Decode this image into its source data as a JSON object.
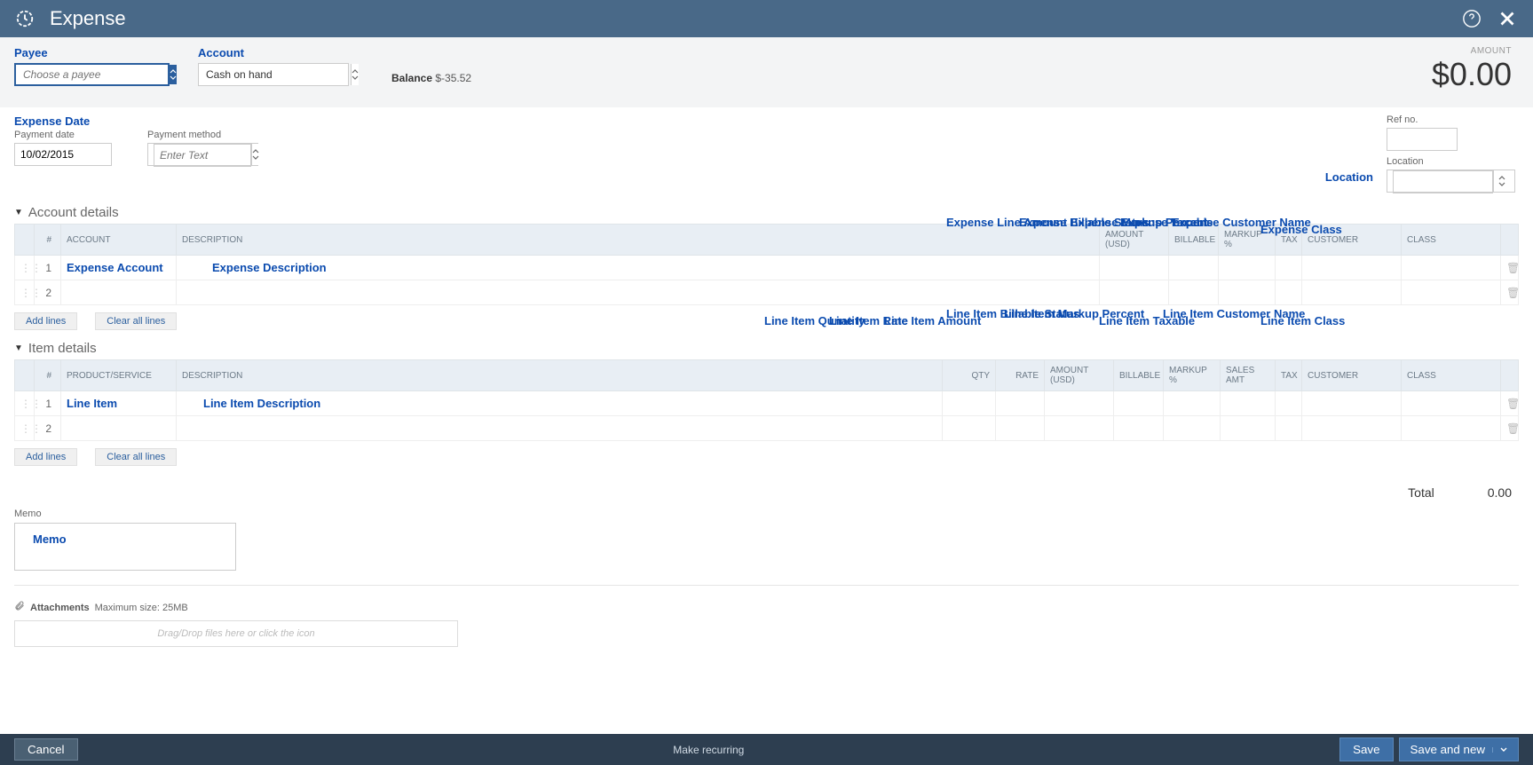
{
  "header": {
    "title": "Expense"
  },
  "top": {
    "payee_label": "Payee",
    "payee_placeholder": "Choose a payee",
    "account_label": "Account",
    "account_value": "Cash on hand",
    "balance_label": "Balance",
    "balance_value": "$-35.52",
    "amount_label": "AMOUNT",
    "amount_value": "$0.00"
  },
  "second_row": {
    "expense_date_label": "Expense Date",
    "payment_date_label": "Payment date",
    "payment_date_value": "10/02/2015",
    "payment_method_label": "Payment method",
    "payment_method_placeholder": "Enter Text",
    "ref_no_label": "Ref no.",
    "location_label": "Location",
    "location_annotation": "Location"
  },
  "account_details": {
    "section_title": "Account details",
    "headers": {
      "num": "#",
      "account": "ACCOUNT",
      "description": "DESCRIPTION",
      "amount": "AMOUNT (USD)",
      "billable": "BILLABLE",
      "markup": "MARKUP %",
      "tax": "TAX",
      "customer": "CUSTOMER",
      "class": "CLASS"
    },
    "col_annotations": {
      "amount": "Expense Line Amount",
      "billable": "Expense Billable Status",
      "markup": "Expense Markup Percent",
      "tax": "Expense Taxable",
      "customer": "Expense Customer Name",
      "class": "Expense Class"
    },
    "rows": [
      {
        "num": "1",
        "account_ann": "Expense Account",
        "description_ann": "Expense Description"
      },
      {
        "num": "2"
      }
    ],
    "add_lines": "Add lines",
    "clear_lines": "Clear all lines"
  },
  "item_details": {
    "section_title": "Item details",
    "headers": {
      "num": "#",
      "product": "PRODUCT/SERVICE",
      "description": "DESCRIPTION",
      "qty": "QTY",
      "rate": "RATE",
      "amount": "AMOUNT (USD)",
      "billable": "BILLABLE",
      "markup": "MARKUP %",
      "sales_amt": "SALES AMT",
      "tax": "TAX",
      "customer": "CUSTOMER",
      "class": "CLASS"
    },
    "col_annotations": {
      "qty": "Line Item Qunatity",
      "rate": "Line Item Rate",
      "amount": "Line Item Amount",
      "billable": "Line Item Billable Status",
      "markup": "Line Item Markup Percent",
      "tax": "Line Item Taxable",
      "customer": "Line Item Customer Name",
      "class": "Line Item Class"
    },
    "rows": [
      {
        "num": "1",
        "product_ann": "Line Item",
        "description_ann": "Line Item Description"
      },
      {
        "num": "2"
      }
    ],
    "add_lines": "Add lines",
    "clear_lines": "Clear all lines"
  },
  "total": {
    "label": "Total",
    "value": "0.00"
  },
  "memo": {
    "label": "Memo",
    "annotation": "Memo"
  },
  "attachments": {
    "title": "Attachments",
    "max_size": "Maximum size: 25MB",
    "placeholder": "Drag/Drop files here or click the icon"
  },
  "footer": {
    "cancel": "Cancel",
    "make_recurring": "Make recurring",
    "save": "Save",
    "save_and_new": "Save and new"
  }
}
